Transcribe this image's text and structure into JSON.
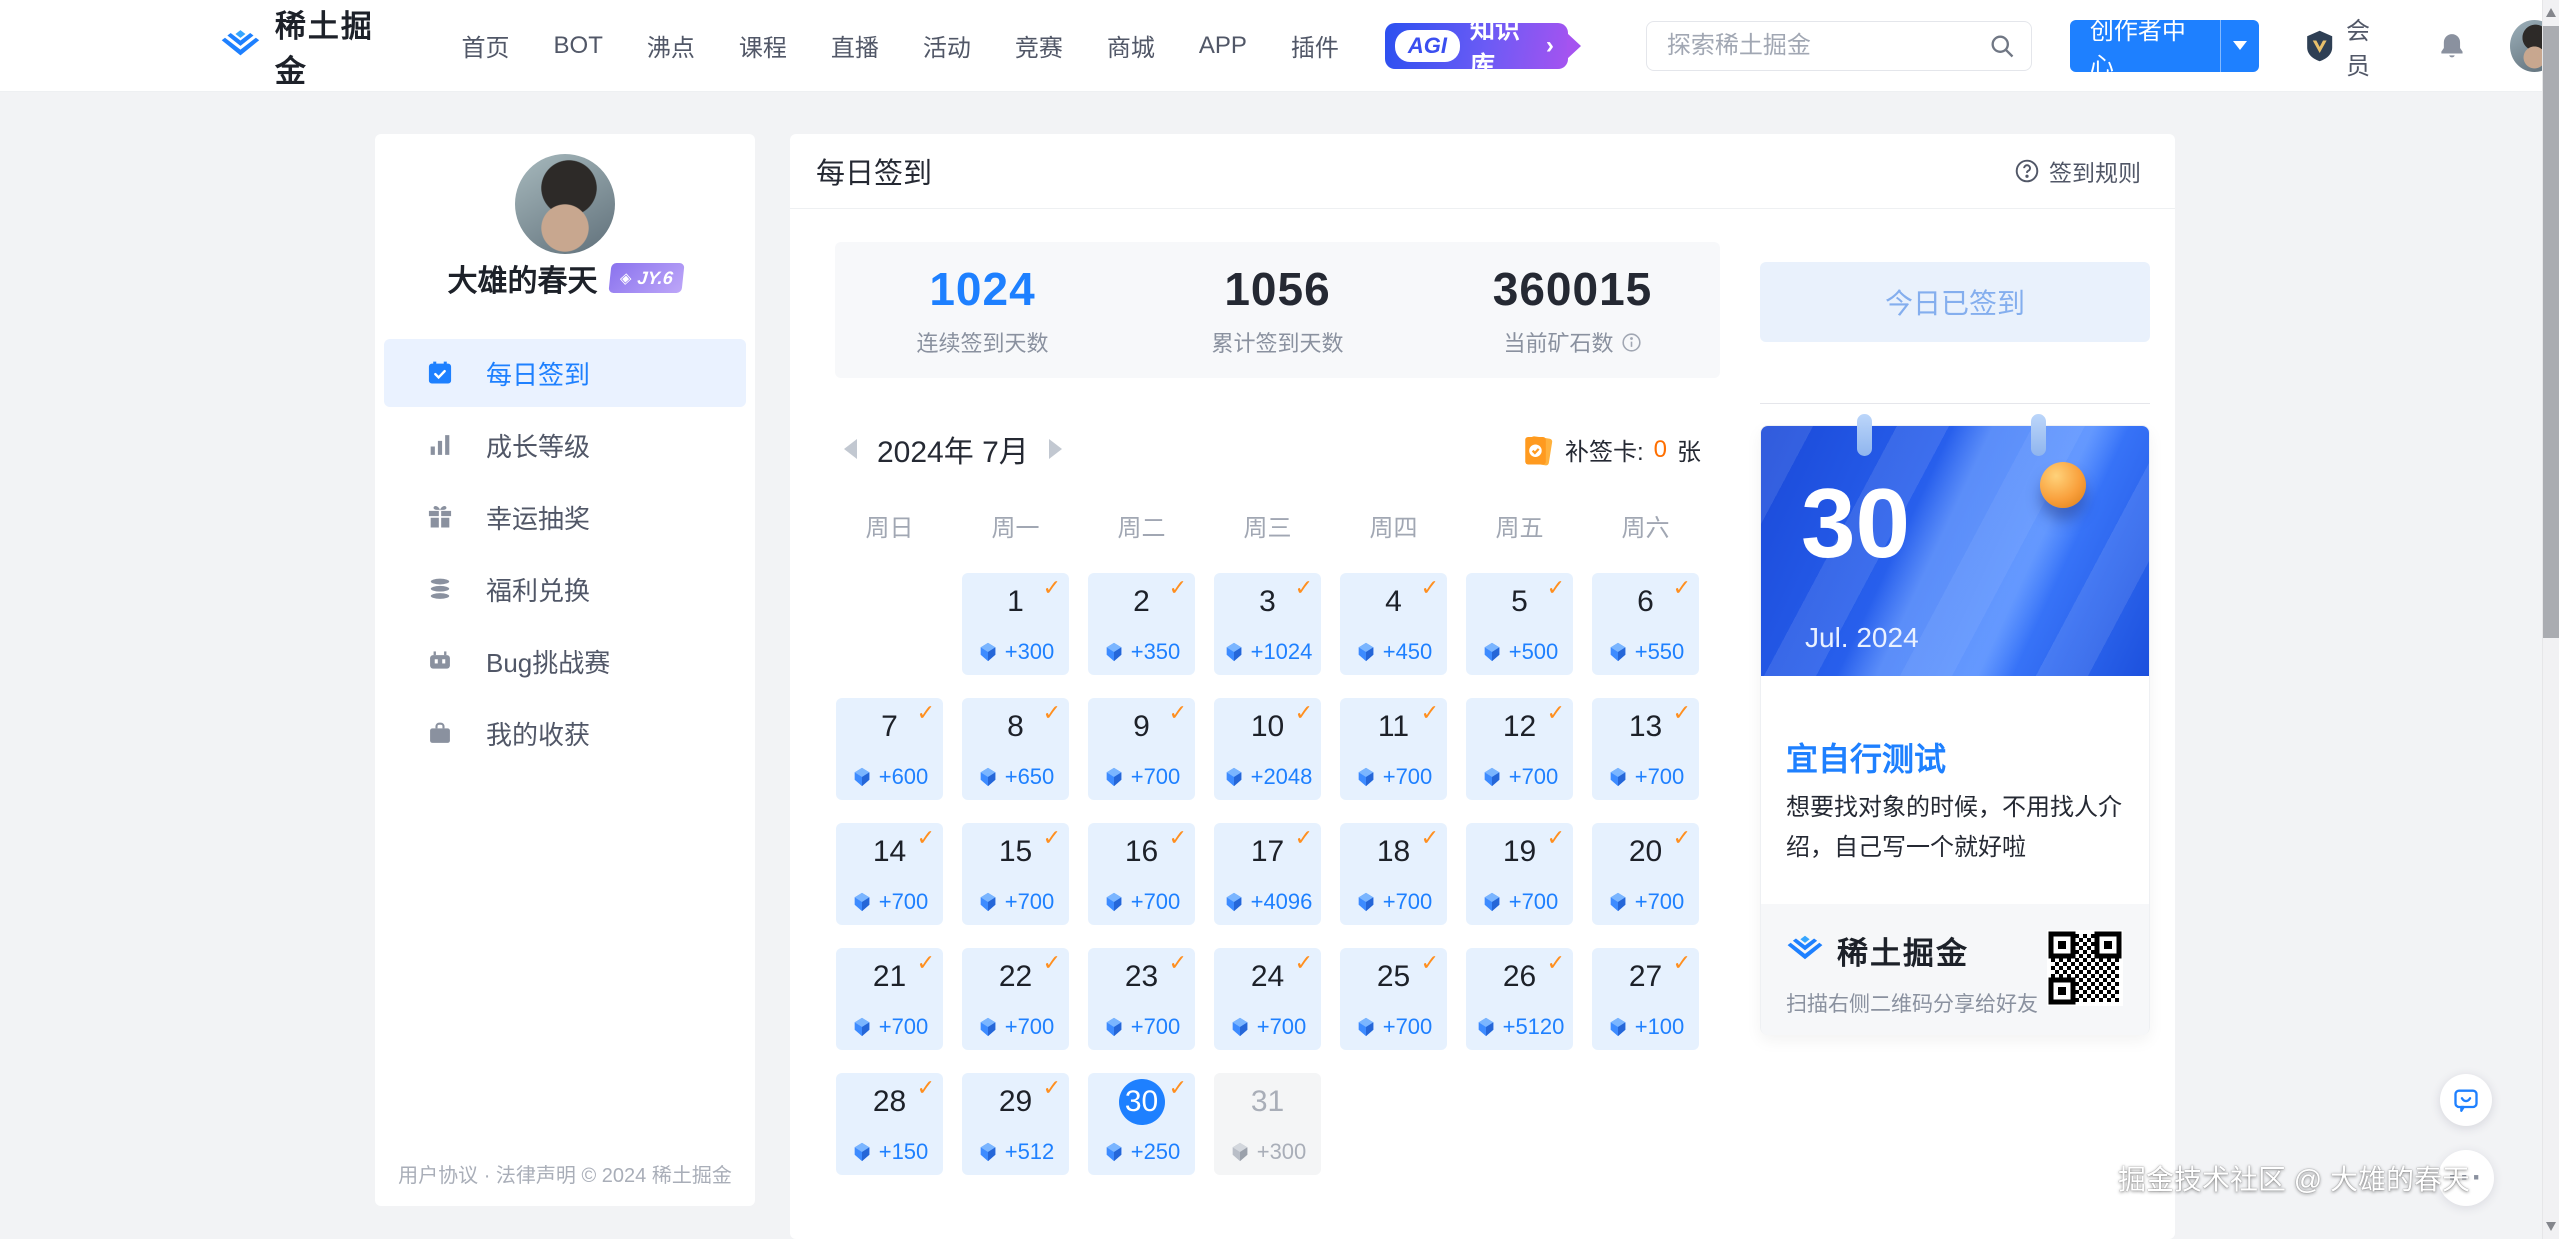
{
  "nav": {
    "brand": "稀土掘金",
    "items": [
      "首页",
      "BOT",
      "沸点",
      "课程",
      "直播",
      "活动",
      "竞赛",
      "商城",
      "APP",
      "插件"
    ],
    "agi_badge": {
      "pill": "AGI",
      "label": "知识库",
      "chevron": "›"
    },
    "search": {
      "placeholder": "探索稀土掘金"
    },
    "creator_button": "创作者中心",
    "member_label": "会员"
  },
  "sidebar": {
    "username": "大雄的春天",
    "level_badge": "JY.6",
    "items": [
      {
        "label": "每日签到"
      },
      {
        "label": "成长等级"
      },
      {
        "label": "幸运抽奖"
      },
      {
        "label": "福利兑换"
      },
      {
        "label": "Bug挑战赛"
      },
      {
        "label": "我的收获"
      }
    ],
    "footer": "用户协议 · 法律声明 © 2024 稀土掘金"
  },
  "main": {
    "title": "每日签到",
    "rules_link": "签到规则",
    "stats": [
      {
        "value": "1024",
        "label": "连续签到天数"
      },
      {
        "value": "1056",
        "label": "累计签到天数"
      },
      {
        "value": "360015",
        "label": "当前矿石数"
      }
    ],
    "calendar": {
      "month_label": "2024年 7月",
      "makeup_card": {
        "label": "补签卡:",
        "count": "0",
        "unit": "张"
      },
      "weekdays": [
        "周日",
        "周一",
        "周二",
        "周三",
        "周四",
        "周五",
        "周六"
      ],
      "days": [
        {
          "state": "empty"
        },
        {
          "d": "1",
          "r": "+300",
          "state": "checked"
        },
        {
          "d": "2",
          "r": "+350",
          "state": "checked"
        },
        {
          "d": "3",
          "r": "+1024",
          "state": "checked"
        },
        {
          "d": "4",
          "r": "+450",
          "state": "checked"
        },
        {
          "d": "5",
          "r": "+500",
          "state": "checked"
        },
        {
          "d": "6",
          "r": "+550",
          "state": "checked"
        },
        {
          "d": "7",
          "r": "+600",
          "state": "checked"
        },
        {
          "d": "8",
          "r": "+650",
          "state": "checked"
        },
        {
          "d": "9",
          "r": "+700",
          "state": "checked"
        },
        {
          "d": "10",
          "r": "+2048",
          "state": "checked"
        },
        {
          "d": "11",
          "r": "+700",
          "state": "checked"
        },
        {
          "d": "12",
          "r": "+700",
          "state": "checked"
        },
        {
          "d": "13",
          "r": "+700",
          "state": "checked"
        },
        {
          "d": "14",
          "r": "+700",
          "state": "checked"
        },
        {
          "d": "15",
          "r": "+700",
          "state": "checked"
        },
        {
          "d": "16",
          "r": "+700",
          "state": "checked"
        },
        {
          "d": "17",
          "r": "+4096",
          "state": "checked"
        },
        {
          "d": "18",
          "r": "+700",
          "state": "checked"
        },
        {
          "d": "19",
          "r": "+700",
          "state": "checked"
        },
        {
          "d": "20",
          "r": "+700",
          "state": "checked"
        },
        {
          "d": "21",
          "r": "+700",
          "state": "checked"
        },
        {
          "d": "22",
          "r": "+700",
          "state": "checked"
        },
        {
          "d": "23",
          "r": "+700",
          "state": "checked"
        },
        {
          "d": "24",
          "r": "+700",
          "state": "checked"
        },
        {
          "d": "25",
          "r": "+700",
          "state": "checked"
        },
        {
          "d": "26",
          "r": "+5120",
          "state": "checked"
        },
        {
          "d": "27",
          "r": "+100",
          "state": "checked"
        },
        {
          "d": "28",
          "r": "+150",
          "state": "checked"
        },
        {
          "d": "29",
          "r": "+512",
          "state": "checked"
        },
        {
          "d": "30",
          "r": "+250",
          "state": "today"
        },
        {
          "d": "31",
          "r": "+300",
          "state": "future"
        }
      ]
    }
  },
  "right": {
    "signed_button": "今日已签到",
    "date_card": {
      "day": "30",
      "month": "Jul. 2024",
      "tip_title": "宜自行测试",
      "tip_text": "想要找对象的时候，不用找人介绍，自己写一个就好啦",
      "brand": "稀土掘金",
      "share_text": "扫描右侧二维码分享给好友"
    }
  },
  "watermark": "掘金技术社区 @ 大雄的春天",
  "colors": {
    "accent": "#1e80ff",
    "check": "#ff8f1f",
    "makeup_count": "#ff6f00"
  }
}
